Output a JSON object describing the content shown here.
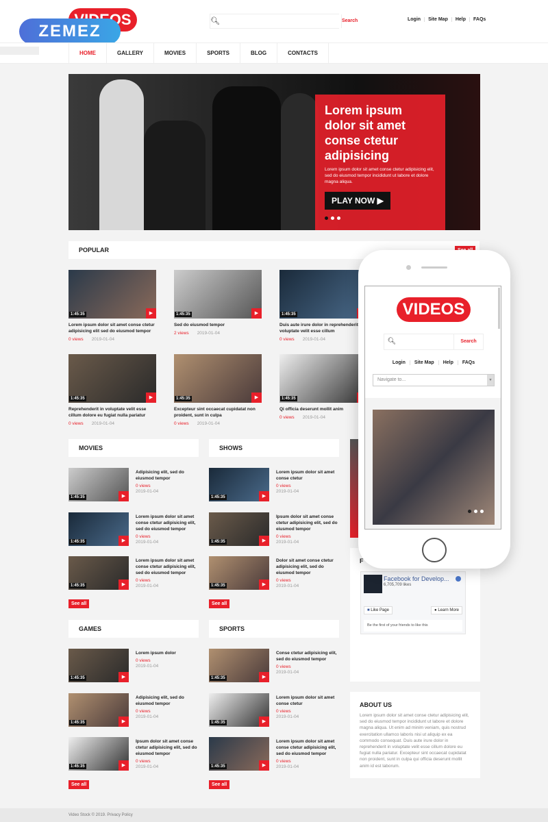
{
  "brand": {
    "logo": "VIDEOS",
    "badge": "ZEMEZ"
  },
  "search": {
    "placeholder": "",
    "button": "Search"
  },
  "top_links": [
    "Login",
    "Site Map",
    "Help",
    "FAQs"
  ],
  "nav": [
    "HOME",
    "GALLERY",
    "MOVIES",
    "SPORTS",
    "BLOG",
    "CONTACTS"
  ],
  "hero": {
    "title": "Lorem ipsum dolor sit amet conse ctetur adipisicing",
    "text": "Lorem ipsum dolor sit amet conse ctetur adipisicing elit, sed do eiusmod tempor incididunt ut labore et dolore magna aliqua.",
    "button": "PLAY NOW ▶",
    "slides": 3,
    "active_slide": 1
  },
  "popular": {
    "title": "POPULAR",
    "see_all": "See all",
    "items": [
      {
        "title": "Lorem ipsum dolor sit amet conse ctetur adipisicing elit sed do eiusmod tempor",
        "views": "0 views",
        "date": "2019-01-04",
        "duration": "1:45:35"
      },
      {
        "title": "Sed do eiusmod tempor",
        "views": "2 views",
        "date": "2019-01-04",
        "duration": "1:45:35"
      },
      {
        "title": "Duis aute irure dolor in reprehenderit in voluptate velit esse cillum",
        "views": "0 views",
        "date": "2019-01-04",
        "duration": "1:45:35"
      },
      {
        "title": "Reprehenderit in voluptate velit esse cillum dolore eu fugiat nulla pariatur",
        "views": "0 views",
        "date": "2019-01-04",
        "duration": "1:45:35"
      },
      {
        "title": "Excepteur sint occaecat cupidatat non proident, sunt in culpa",
        "views": "0 views",
        "date": "2019-01-04",
        "duration": "1:45:35"
      },
      {
        "title": "Qi officia deserunt mollit anim",
        "views": "0 views",
        "date": "2019-01-04",
        "duration": "1:45:35"
      }
    ]
  },
  "sections": [
    {
      "title": "MOVIES",
      "see_all": "See all",
      "items": [
        {
          "title": "Adipisicing elit, sed do eiusmod tempor",
          "views": "0 views",
          "date": "2019-01-04",
          "duration": "1:45:35"
        },
        {
          "title": "Lorem ipsum dolor sit amet conse ctetur adipisicing elit, sed do eiusmod tempor",
          "views": "0 views",
          "date": "2019-01-04",
          "duration": "1:45:35"
        },
        {
          "title": "Lorem ipsum dolor sit amet conse ctetur adipisicing elit, sed do eiusmod tempor",
          "views": "0 views",
          "date": "2019-01-04",
          "duration": "1:45:35"
        }
      ]
    },
    {
      "title": "SHOWS",
      "see_all": "See all",
      "items": [
        {
          "title": "Lorem ipsum dolor sit amet conse ctetur",
          "views": "0 views",
          "date": "2019-01-04",
          "duration": "1:45:35"
        },
        {
          "title": "Ipsum dolor sit amet conse ctetur adipisicing elit, sed do eiusmod tempor",
          "views": "0 views",
          "date": "2019-01-04",
          "duration": "1:45:35"
        },
        {
          "title": "Dolor sit amet conse ctetur adipisicing elit, sed do eiusmod tempor",
          "views": "0 views",
          "date": "2019-01-04",
          "duration": "1:45:35"
        }
      ]
    },
    {
      "title": "GAMES",
      "see_all": "See all",
      "items": [
        {
          "title": "Lorem ipsum dolor",
          "views": "0 views",
          "date": "2019-01-04",
          "duration": "1:45:35"
        },
        {
          "title": "Adipisicing elit, sed do eiusmod tempor",
          "views": "0 views",
          "date": "2019-01-04",
          "duration": "1:45:35"
        },
        {
          "title": "Ipsum dolor sit amet conse ctetur adipisicing elit, sed do eiusmod tempor",
          "views": "0 views",
          "date": "2019-01-04",
          "duration": "1:45:35"
        }
      ]
    },
    {
      "title": "SPORTS",
      "see_all": "See all",
      "items": [
        {
          "title": "Conse ctetur adipisicing elit, sed do eiusmod tempor",
          "views": "0 views",
          "date": "2019-01-04",
          "duration": "1:45:35"
        },
        {
          "title": "Lorem ipsum dolor sit amet conse ctetur",
          "views": "0 views",
          "date": "2019-01-04",
          "duration": "1:45:35"
        },
        {
          "title": "Lorem ipsum dolor sit amet conse ctetur adipisicing elit, sed do eiusmod tempor",
          "views": "0 views",
          "date": "2019-01-04",
          "duration": "1:45:35"
        }
      ]
    }
  ],
  "facebook": {
    "heading": "F",
    "page_name": "Facebook for Develop...",
    "likes": "6,705,709 likes",
    "like_button": "Like Page",
    "learn_button": "Learn More",
    "friends_text": "Be the first of your friends to like this"
  },
  "about": {
    "title": "ABOUT US",
    "text": "Lorem ipsum dolor sit amet conse ctetur adipisicing elit, sed do eiusmod tempor incididunt ut labore et dolore magna aliqua. Ut enim ad minim veniam, quis nostrud exercitation ullamco laboris nisi ut aliquip ex ea commodo consequat. Duis aute irure dolor in reprehenderit in voluptate velit esse cillum dolore eu fugiat nulla pariatur. Excepteur sint occaecat cupidatat non proident, sunt in culpa qui officia deserunt mollit anim id est laborum."
  },
  "footer": "Video Stock © 2019. Privacy Policy",
  "mobile": {
    "logo": "VIDEOS",
    "search_button": "Search",
    "links": [
      "Login",
      "Site Map",
      "Help",
      "FAQs"
    ],
    "nav_placeholder": "Navigate to...",
    "slides": 3,
    "active_slide": 1
  },
  "colors": {
    "accent": "#e8202a",
    "badge_start": "#4e6fd8",
    "badge_end": "#3aa6e6",
    "background": "#f3f3f3"
  }
}
